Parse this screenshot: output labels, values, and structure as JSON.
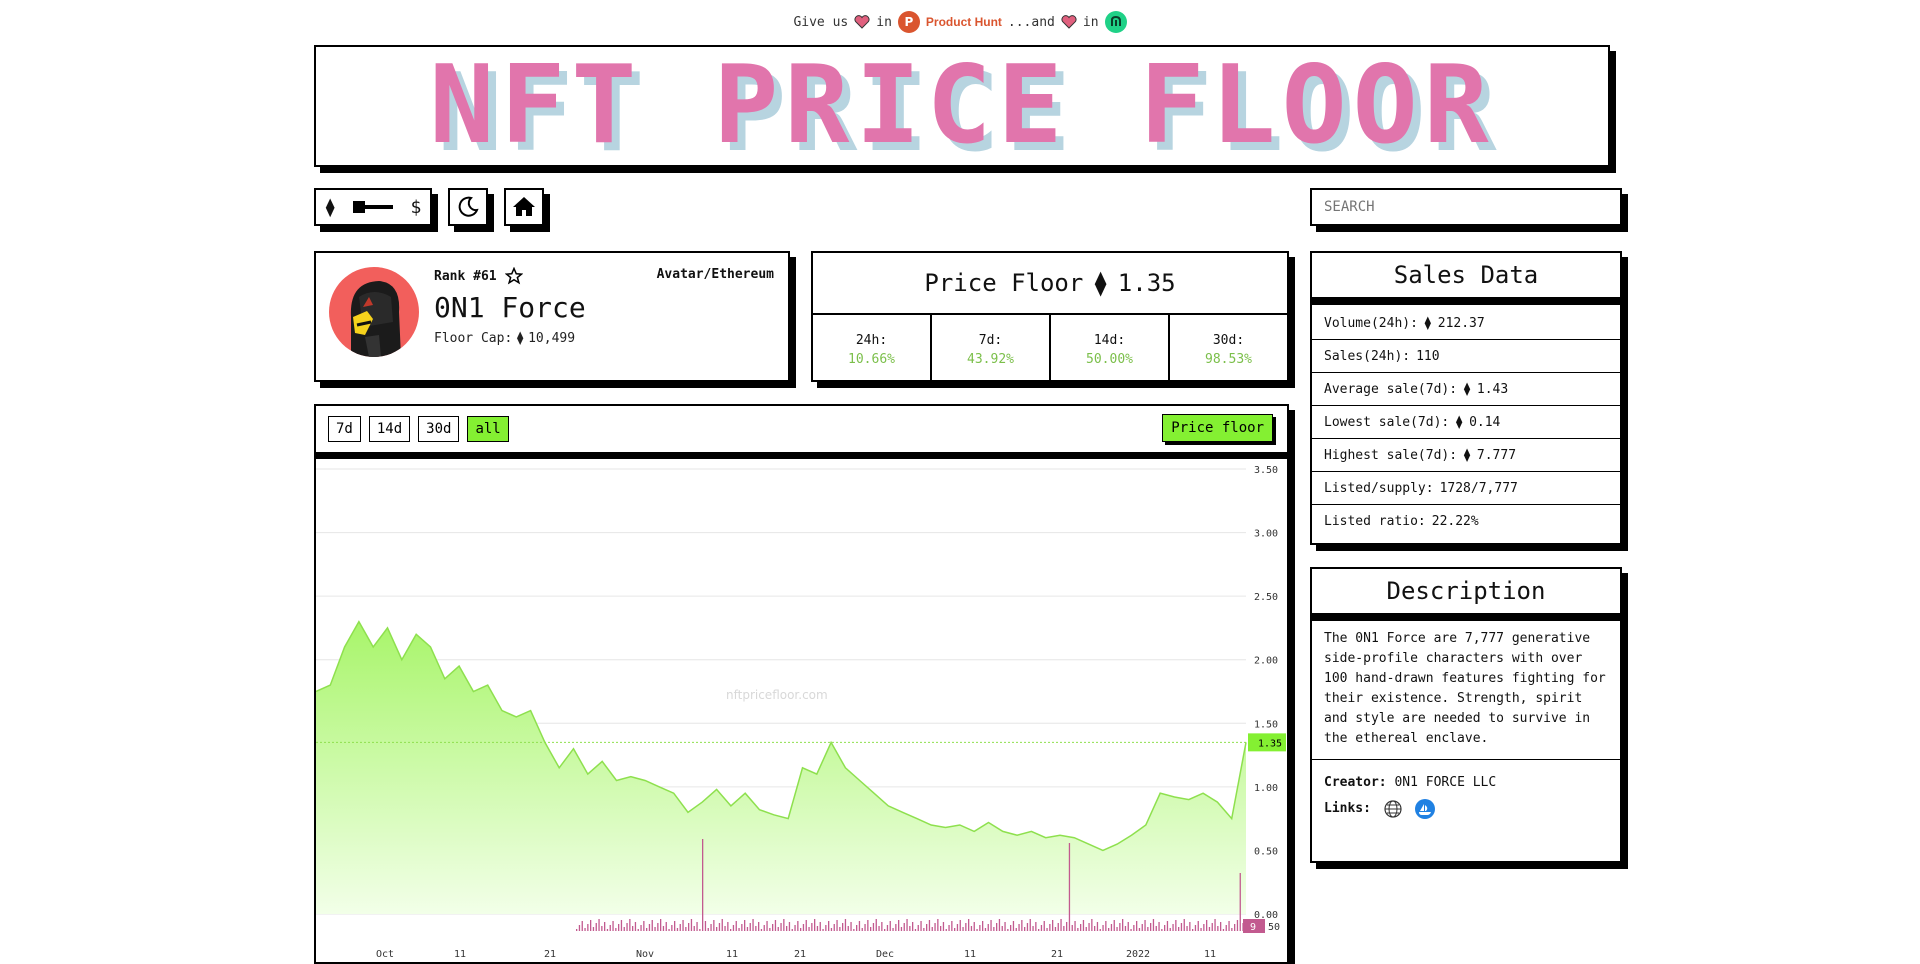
{
  "topbar": {
    "give_us": "Give us",
    "in1": "in",
    "ph_letter": "P",
    "ph_label": "Product Hunt",
    "and": "...and",
    "in2": "in"
  },
  "banner": {
    "title": "NFT PRICE FLOOR"
  },
  "controls": {
    "eth_symbol": "⧫",
    "usd_symbol": "$",
    "moon_icon": "moon-icon",
    "home_icon": "home-icon",
    "search_placeholder": "SEARCH"
  },
  "collection": {
    "rank": "Rank #61",
    "category": "Avatar/Ethereum",
    "name": "0N1 Force",
    "floor_cap_label": "Floor Cap:",
    "floor_cap_value": "10,499"
  },
  "price_floor": {
    "label": "Price Floor",
    "value": "1.35",
    "changes": [
      {
        "period": "24h:",
        "pct": "10.66%"
      },
      {
        "period": "7d:",
        "pct": "43.92%"
      },
      {
        "period": "14d:",
        "pct": "50.00%"
      },
      {
        "period": "30d:",
        "pct": "98.53%"
      }
    ]
  },
  "chart_controls": {
    "ranges": [
      "7d",
      "14d",
      "30d",
      "all"
    ],
    "active_range": "all",
    "series_button": "Price floor"
  },
  "chart_data": {
    "type": "area",
    "watermark": "nftpricefloor.com",
    "y_ticks": [
      "3.50",
      "3.00",
      "2.50",
      "2.00",
      "1.50",
      "1.00",
      "0.50",
      "0.00"
    ],
    "ylim": [
      0,
      3.5
    ],
    "current_value_label": "1.35",
    "volume_axis_label": "50",
    "volume_badge": "9",
    "x_ticks": [
      "Oct",
      "11",
      "21",
      "Nov",
      "11",
      "21",
      "Dec",
      "11",
      "21",
      "2022",
      "11"
    ],
    "series": [
      {
        "values": [
          1.75,
          1.8,
          2.1,
          2.3,
          2.1,
          2.25,
          2.0,
          2.2,
          2.1,
          1.85,
          1.95,
          1.75,
          1.8,
          1.6,
          1.55,
          1.6,
          1.35,
          1.15,
          1.3,
          1.1,
          1.2,
          1.05,
          1.08,
          1.05,
          1.0,
          0.95,
          0.8,
          0.88,
          0.98,
          0.85,
          0.95,
          0.82,
          0.78,
          0.75,
          1.15,
          1.1,
          1.35,
          1.15,
          1.05,
          0.95,
          0.85,
          0.8,
          0.75,
          0.7,
          0.68,
          0.7,
          0.65,
          0.72,
          0.65,
          0.62,
          0.65,
          0.6,
          0.62,
          0.6,
          0.55,
          0.5,
          0.55,
          0.62,
          0.7,
          0.95,
          0.92,
          0.9,
          0.95,
          0.88,
          0.75,
          1.35
        ]
      }
    ],
    "grid": true,
    "colors": {
      "area_top": "#a8f56a",
      "area_bottom": "#f2ffe8",
      "line": "#8ee04e",
      "volume": "#c25a8f",
      "label_bg": "#84f032"
    }
  },
  "sales": {
    "title": "Sales Data",
    "rows": [
      {
        "label": "Volume(24h):",
        "eth": true,
        "value": "212.37"
      },
      {
        "label": "Sales(24h):",
        "eth": false,
        "value": "110"
      },
      {
        "label": "Average sale(7d):",
        "eth": true,
        "value": "1.43"
      },
      {
        "label": "Lowest sale(7d):",
        "eth": true,
        "value": "0.14"
      },
      {
        "label": "Highest sale(7d):",
        "eth": true,
        "value": "7.777"
      },
      {
        "label": "Listed/supply:",
        "eth": false,
        "value": "1728/7,777"
      },
      {
        "label": "Listed ratio:",
        "eth": false,
        "value": "22.22%"
      }
    ]
  },
  "description": {
    "title": "Description",
    "text": "The 0N1 Force are 7,777 generative side-profile characters with over 100 hand-drawn features fighting for their existence. Strength, spirit and style are needed to survive in the ethereal enclave.",
    "creator_label": "Creator:",
    "creator_value": "0N1 FORCE LLC",
    "links_label": "Links:"
  }
}
